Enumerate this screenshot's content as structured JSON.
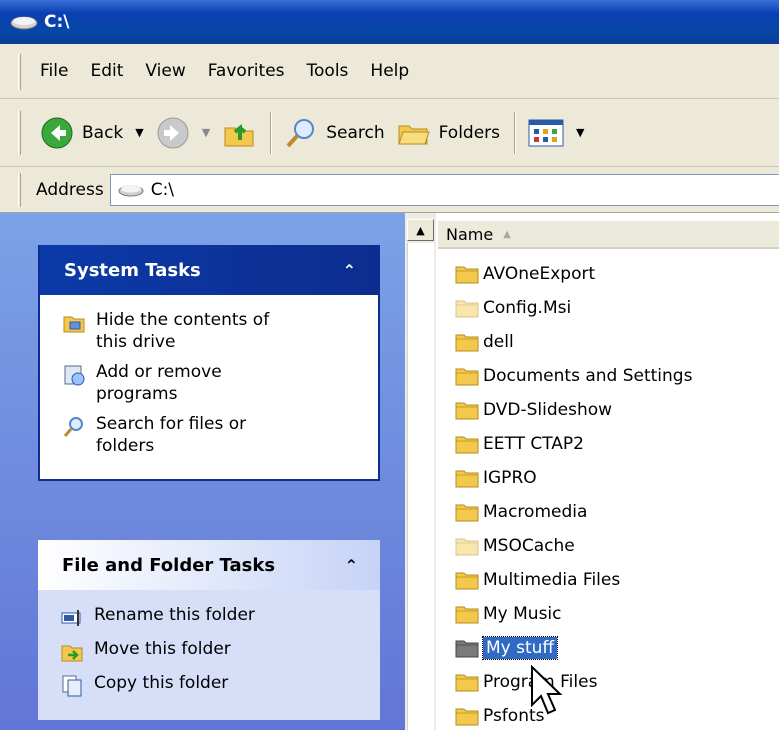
{
  "window": {
    "title": "C:\\"
  },
  "menu": [
    "File",
    "Edit",
    "View",
    "Favorites",
    "Tools",
    "Help"
  ],
  "toolbar": {
    "back_label": "Back",
    "search_label": "Search",
    "folders_label": "Folders"
  },
  "address": {
    "label": "Address",
    "value": "C:\\"
  },
  "system_tasks": {
    "title": "System Tasks",
    "items": [
      {
        "label": "Hide the contents of\nthis drive",
        "line1": "Hide the contents of",
        "line2": "this drive",
        "icon": "hide-contents-icon"
      },
      {
        "label": "Add or remove programs",
        "line1": "Add or remove",
        "line2": "programs",
        "icon": "add-remove-programs-icon"
      },
      {
        "label": "Search for files or folders",
        "line1": "Search for files or",
        "line2": "folders",
        "icon": "search-icon"
      }
    ]
  },
  "file_folder_tasks": {
    "title": "File and Folder Tasks",
    "items": [
      {
        "label": "Rename this folder",
        "icon": "rename-icon"
      },
      {
        "label": "Move this folder",
        "icon": "move-icon"
      },
      {
        "label": "Copy this folder",
        "icon": "copy-icon"
      }
    ]
  },
  "file_list": {
    "column_name": "Name",
    "items": [
      {
        "name": "AVOneExport",
        "style": "normal"
      },
      {
        "name": "Config.Msi",
        "style": "faded"
      },
      {
        "name": "dell",
        "style": "normal"
      },
      {
        "name": "Documents and Settings",
        "style": "normal"
      },
      {
        "name": "DVD-Slideshow",
        "style": "normal"
      },
      {
        "name": "EETT CTAP2",
        "style": "normal"
      },
      {
        "name": "IGPRO",
        "style": "normal"
      },
      {
        "name": "Macromedia",
        "style": "normal"
      },
      {
        "name": "MSOCache",
        "style": "faded"
      },
      {
        "name": "Multimedia Files",
        "style": "normal"
      },
      {
        "name": "My Music",
        "style": "normal"
      },
      {
        "name": "My stuff",
        "style": "selected"
      },
      {
        "name": "Program Files",
        "style": "normal"
      },
      {
        "name": "Psfonts",
        "style": "normal"
      }
    ]
  },
  "colors": {
    "title_bar": "#0a3fb3",
    "chrome": "#ece9d8",
    "task_pane": "#6f8be0",
    "selection": "#316ac5",
    "folder": "#f2c94c"
  }
}
